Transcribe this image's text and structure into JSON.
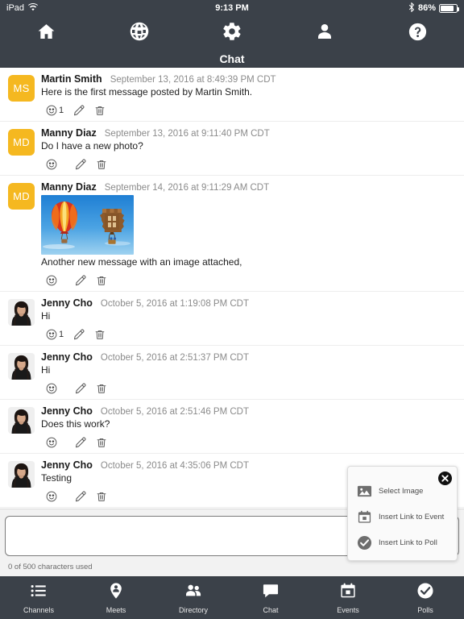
{
  "statusbar": {
    "device": "iPad",
    "wifi_icon": "wifi-icon",
    "time": "9:13 PM",
    "bluetooth_icon": "bluetooth-icon",
    "battery_percent": "86%",
    "battery_icon": "battery-icon"
  },
  "topnav": {
    "items": [
      {
        "name": "home",
        "icon": "home-icon"
      },
      {
        "name": "globe",
        "icon": "globe-icon"
      },
      {
        "name": "settings",
        "icon": "gear-icon"
      },
      {
        "name": "profile",
        "icon": "person-icon"
      },
      {
        "name": "help",
        "icon": "question-mark-icon"
      }
    ]
  },
  "titlebar": {
    "title": "Chat"
  },
  "colors": {
    "chrome": "#3b4149",
    "avatar_initials_bg": "#f5b820",
    "accent_text": "#8b8b8b"
  },
  "messages": [
    {
      "avatar_type": "initials",
      "initials": "MS",
      "author": "Martin Smith",
      "time": "September 13, 2016 at 8:49:39 PM CDT",
      "text": "Here is the first message posted by Martin Smith.",
      "reaction_count": "1",
      "has_image": false
    },
    {
      "avatar_type": "initials",
      "initials": "MD",
      "author": "Manny Diaz",
      "time": "September 13, 2016 at 9:11:40 PM CDT",
      "text": "Do I have a new photo?",
      "reaction_count": "",
      "has_image": false
    },
    {
      "avatar_type": "initials",
      "initials": "MD",
      "author": "Manny Diaz",
      "time": "September 14, 2016 at 9:11:29 AM CDT",
      "text": "Another new message with an image attached,",
      "reaction_count": "",
      "has_image": true,
      "image_alt": "two hot air balloons in a blue sky"
    },
    {
      "avatar_type": "photo",
      "initials": "",
      "author": "Jenny Cho",
      "time": "October 5, 2016 at 1:19:08 PM CDT",
      "text": "Hi",
      "reaction_count": "1",
      "has_image": false
    },
    {
      "avatar_type": "photo",
      "initials": "",
      "author": "Jenny Cho",
      "time": "October 5, 2016 at 2:51:37 PM CDT",
      "text": "Hi",
      "reaction_count": "",
      "has_image": false
    },
    {
      "avatar_type": "photo",
      "initials": "",
      "author": "Jenny Cho",
      "time": "October 5, 2016 at 2:51:46 PM CDT",
      "text": "Does this work?",
      "reaction_count": "",
      "has_image": false
    },
    {
      "avatar_type": "photo",
      "initials": "",
      "author": "Jenny Cho",
      "time": "October 5, 2016 at 4:35:06 PM CDT",
      "text": "Testing",
      "reaction_count": "",
      "has_image": false
    }
  ],
  "message_actions": {
    "react_icon": "smiley-face-icon",
    "edit_icon": "pencil-icon",
    "delete_icon": "trash-icon"
  },
  "composer": {
    "value": "",
    "placeholder": "",
    "char_count": "0 of 500 characters used"
  },
  "attachment_popup": {
    "close_icon": "close-circle-icon",
    "items": [
      {
        "label": "Select Image",
        "icon": "image-icon"
      },
      {
        "label": "Insert Link to Event",
        "icon": "calendar-icon"
      },
      {
        "label": "Insert Link to Poll",
        "icon": "check-circle-icon"
      }
    ]
  },
  "tabbar": {
    "items": [
      {
        "label": "Channels",
        "icon": "list-icon"
      },
      {
        "label": "Meets",
        "icon": "map-pin-person-icon"
      },
      {
        "label": "Directory",
        "icon": "people-icon"
      },
      {
        "label": "Chat",
        "icon": "speech-bubble-icon"
      },
      {
        "label": "Events",
        "icon": "calendar-icon"
      },
      {
        "label": "Polls",
        "icon": "check-circle-icon"
      }
    ]
  }
}
